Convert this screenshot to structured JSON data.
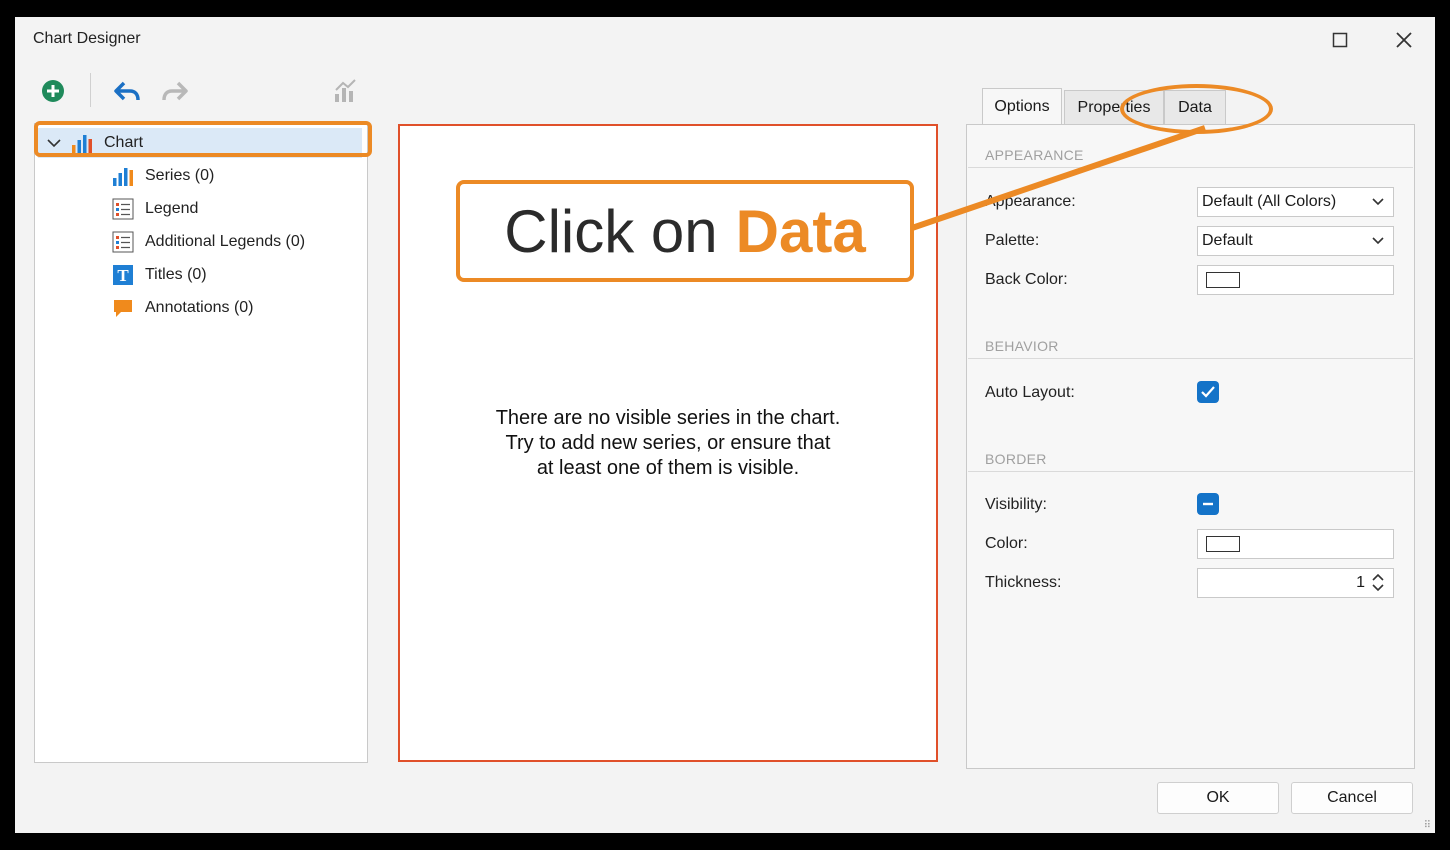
{
  "window": {
    "title": "Chart Designer"
  },
  "toolbar": {
    "icons": [
      "add-icon",
      "undo-icon",
      "redo-icon",
      "chart-wizard-icon"
    ]
  },
  "tree": {
    "root": {
      "label": "Chart",
      "icon": "bar-chart-icon"
    },
    "items": [
      {
        "label": "Series (0)",
        "icon": "bar-chart-icon"
      },
      {
        "label": "Legend",
        "icon": "legend-icon"
      },
      {
        "label": "Additional Legends (0)",
        "icon": "legend-icon"
      },
      {
        "label": "Titles (0)",
        "icon": "title-icon"
      },
      {
        "label": "Annotations (0)",
        "icon": "annotation-icon"
      }
    ]
  },
  "chart_area": {
    "message_lines": [
      "There are no visible series in the chart.",
      "Try to add new series, or ensure that",
      "at least one of them is visible."
    ]
  },
  "callout": {
    "prefix": "Click on",
    "highlight": "Data"
  },
  "tabs": [
    {
      "label": "Options",
      "active": true
    },
    {
      "label": "Properties",
      "active": false
    },
    {
      "label": "Data",
      "active": false
    }
  ],
  "properties": {
    "sections": {
      "appearance": "APPEARANCE",
      "behavior": "BEHAVIOR",
      "border": "BORDER"
    },
    "appearance_label": "Appearance:",
    "appearance_value": "Default (All Colors)",
    "palette_label": "Palette:",
    "palette_value": "Default",
    "back_color_label": "Back Color:",
    "auto_layout_label": "Auto Layout:",
    "visibility_label": "Visibility:",
    "color_label": "Color:",
    "thickness_label": "Thickness:",
    "thickness_value": "1"
  },
  "buttons": {
    "ok": "OK",
    "cancel": "Cancel"
  },
  "colors": {
    "highlight": "#ec8a25",
    "chart_border": "#e0502a",
    "accent": "#1473c8"
  }
}
